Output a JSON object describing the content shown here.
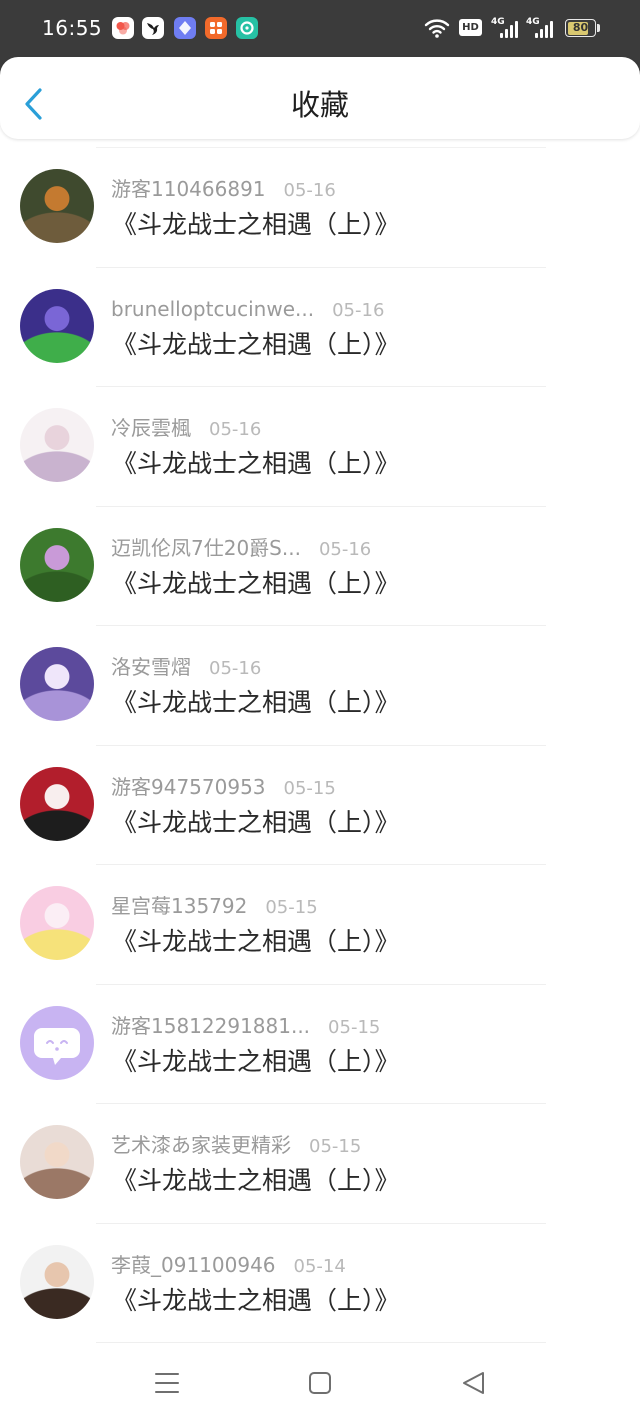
{
  "status_bar": {
    "time": "16:55",
    "notifications": [
      {
        "icon": "flower-app-icon",
        "bg": "#ffffff",
        "fg": "#f2574b"
      },
      {
        "icon": "bird-app-icon",
        "bg": "#ffffff",
        "fg": "#1e1e1e"
      },
      {
        "icon": "diamond-app-icon",
        "bg": "#6f7df2",
        "fg": "#ffffff"
      },
      {
        "icon": "grid-app-icon",
        "bg": "#f26a2b",
        "fg": "#ffffff"
      },
      {
        "icon": "chat-app-icon",
        "bg": "#26c1a4",
        "fg": "#ffffff"
      }
    ],
    "wifi_icon": "wifi-icon",
    "hd_label": "HD",
    "signals": [
      {
        "network": "4G"
      },
      {
        "network": "4G"
      }
    ],
    "battery_level": 80
  },
  "header": {
    "back_icon": "chevron-left-icon",
    "title": "收藏"
  },
  "favorites": [
    {
      "user": "游客110466891",
      "date": "05-16",
      "title": "《斗龙战士之相遇（上）》",
      "avatar_colors": [
        "#3f4a2e",
        "#6e5c3c",
        "#c47a30"
      ]
    },
    {
      "user": "brunelloptcucinwe...",
      "date": "05-16",
      "title": "《斗龙战士之相遇（上）》",
      "avatar_colors": [
        "#3b2f8a",
        "#3fae4a",
        "#7a66d6"
      ]
    },
    {
      "user": "冷辰雲楓",
      "date": "05-16",
      "title": "《斗龙战士之相遇（上）》",
      "avatar_colors": [
        "#f6f1f3",
        "#c9b3cf",
        "#e8d3dc"
      ]
    },
    {
      "user": "迈凯伦凤7仕20爵S...",
      "date": "05-16",
      "title": "《斗龙战士之相遇（上）》",
      "avatar_colors": [
        "#3d7a2e",
        "#2e5f22",
        "#c99ad8"
      ]
    },
    {
      "user": "洛安雪熠",
      "date": "05-16",
      "title": "《斗龙战士之相遇（上）》",
      "avatar_colors": [
        "#5c4a9c",
        "#a893d8",
        "#efe6fa"
      ]
    },
    {
      "user": "游客947570953",
      "date": "05-15",
      "title": "《斗龙战士之相遇（上）》",
      "avatar_colors": [
        "#b21e2c",
        "#1d1d1d",
        "#f8eeee"
      ]
    },
    {
      "user": "星宫莓135792",
      "date": "05-15",
      "title": "《斗龙战士之相遇（上）》",
      "avatar_colors": [
        "#f9cde2",
        "#f6e27a",
        "#fbeef5"
      ]
    },
    {
      "user": "游客15812291881...",
      "date": "05-15",
      "title": "《斗龙战士之相遇（上）》",
      "avatar_colors": [
        "#c8b4f2",
        "#ffffff",
        "#c8b4f2"
      ],
      "avatar_icon": "chat-bubble-icon"
    },
    {
      "user": "艺术漆あ家装更精彩",
      "date": "05-15",
      "title": "《斗龙战士之相遇（上）》",
      "avatar_colors": [
        "#e9dcd6",
        "#9b7866",
        "#f1d9c8"
      ]
    },
    {
      "user": "李葭_091100946",
      "date": "05-14",
      "title": "《斗龙战士之相遇（上）》",
      "avatar_colors": [
        "#f2f2f2",
        "#3a2a22",
        "#e7c6ae"
      ]
    }
  ],
  "nav_bar": {
    "icons": [
      "menu-icon",
      "home-square-icon",
      "back-triangle-icon"
    ]
  },
  "colors": {
    "status_bar_bg": "#3b3b3b",
    "accent": "#2a9fd8",
    "battery_fill": "#d9c870",
    "username": "#9a9a9a",
    "date": "#b9b9b9",
    "title": "#2a2a2a"
  }
}
